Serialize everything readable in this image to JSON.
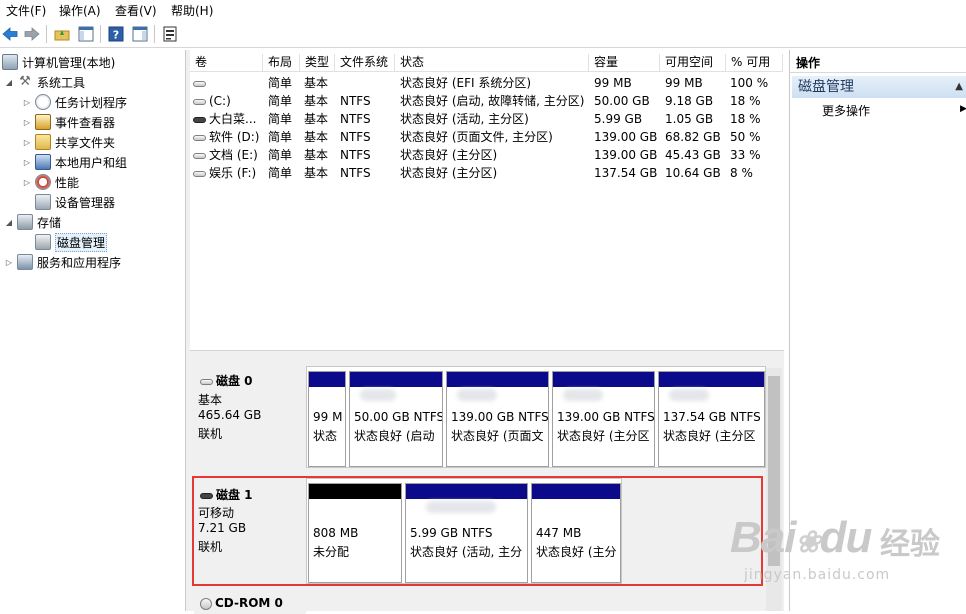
{
  "menu": {
    "file": "文件(F)",
    "action": "操作(A)",
    "view": "查看(V)",
    "help": "帮助(H)"
  },
  "tree": {
    "root": "计算机管理(本地)",
    "system_tools": "系统工具",
    "task_scheduler": "任务计划程序",
    "event_viewer": "事件查看器",
    "shared_folders": "共享文件夹",
    "local_users": "本地用户和组",
    "performance": "性能",
    "device_manager": "设备管理器",
    "storage": "存储",
    "disk_management": "磁盘管理",
    "services": "服务和应用程序"
  },
  "volumes": {
    "headers": [
      "卷",
      "布局",
      "类型",
      "文件系统",
      "状态",
      "容量",
      "可用空间",
      "% 可用"
    ],
    "rows": [
      {
        "name": "",
        "layout": "简单",
        "type": "基本",
        "fs": "",
        "status": "状态良好 (EFI 系统分区)",
        "capacity": "99 MB",
        "free": "99 MB",
        "pct": "100 %"
      },
      {
        "name": "(C:)",
        "layout": "简单",
        "type": "基本",
        "fs": "NTFS",
        "status": "状态良好 (启动, 故障转储, 主分区)",
        "capacity": "50.00 GB",
        "free": "9.18 GB",
        "pct": "18 %"
      },
      {
        "name": "大白菜...",
        "layout": "简单",
        "type": "基本",
        "fs": "NTFS",
        "status": "状态良好 (活动, 主分区)",
        "capacity": "5.99 GB",
        "free": "1.05 GB",
        "pct": "18 %"
      },
      {
        "name": "软件 (D:)",
        "layout": "简单",
        "type": "基本",
        "fs": "NTFS",
        "status": "状态良好 (页面文件, 主分区)",
        "capacity": "139.00 GB",
        "free": "68.82 GB",
        "pct": "50 %"
      },
      {
        "name": "文档 (E:)",
        "layout": "简单",
        "type": "基本",
        "fs": "NTFS",
        "status": "状态良好 (主分区)",
        "capacity": "139.00 GB",
        "free": "45.43 GB",
        "pct": "33 %"
      },
      {
        "name": "娱乐 (F:)",
        "layout": "简单",
        "type": "基本",
        "fs": "NTFS",
        "status": "状态良好 (主分区)",
        "capacity": "137.54 GB",
        "free": "10.64 GB",
        "pct": "8 %"
      }
    ]
  },
  "disks": [
    {
      "name": "磁盘 0",
      "type": "基本",
      "size": "465.64 GB",
      "state": "联机",
      "partitions": [
        {
          "line1": "99 M",
          "line2": "状态"
        },
        {
          "line1": "50.00 GB NTFS",
          "line2": "状态良好 (启动"
        },
        {
          "line1": "139.00 GB NTFS",
          "line2": "状态良好 (页面文"
        },
        {
          "line1": "139.00 GB NTFS",
          "line2": "状态良好 (主分区"
        },
        {
          "line1": "137.54 GB NTFS",
          "line2": "状态良好 (主分区"
        }
      ]
    },
    {
      "name": "磁盘 1",
      "type": "可移动",
      "size": "7.21 GB",
      "state": "联机",
      "partitions": [
        {
          "line1": "808 MB",
          "line2": "未分配"
        },
        {
          "line1": "5.99 GB NTFS",
          "line2": "状态良好 (活动, 主分"
        },
        {
          "line1": "447 MB",
          "line2": "状态良好 (主分"
        }
      ]
    },
    {
      "name": "CD-ROM 0"
    }
  ],
  "actions": {
    "header": "操作",
    "group": "磁盘管理",
    "more": "更多操作"
  },
  "watermark": {
    "brand": "Bai",
    "brand2": "du",
    "cn": "经验",
    "url": "jingyan.baidu.com"
  },
  "colors": {
    "primary_partition": "#0a0a8a",
    "unallocated": "#000000",
    "highlight": "#e53935",
    "selection": "#e5f1fb"
  }
}
